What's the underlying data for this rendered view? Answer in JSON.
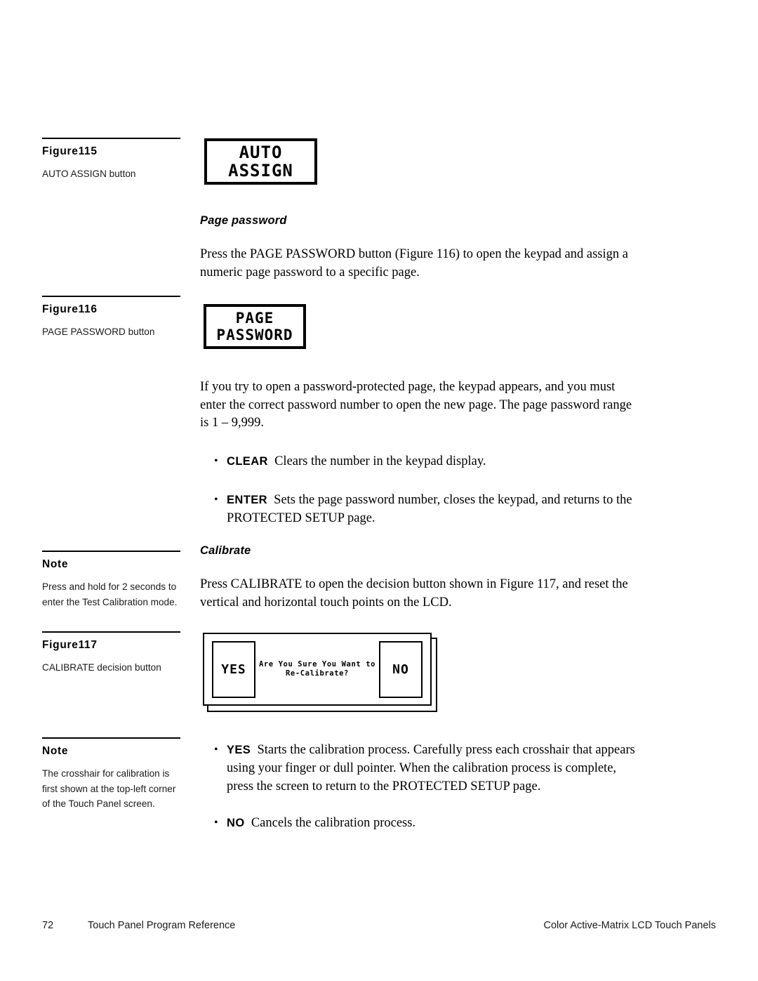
{
  "document": {
    "page_number": "72",
    "footer_left": "Touch Panel Program Reference",
    "footer_right": "Color Active-Matrix LCD Touch Panels"
  },
  "figures": {
    "fig115": {
      "label": "Figure115",
      "caption": "AUTO ASSIGN button",
      "button_line1": "AUTO",
      "button_line2": "ASSIGN"
    },
    "fig116": {
      "label": "Figure116",
      "caption": "PAGE PASSWORD button",
      "button_line1": "PAGE",
      "button_line2": "PASSWORD"
    },
    "fig117": {
      "label": "Figure117",
      "caption": "CALIBRATE decision button",
      "yes_label": "YES",
      "no_label": "NO",
      "prompt_line1": "Are You Sure You Want to",
      "prompt_line2": "Re-Calibrate?"
    }
  },
  "notes": {
    "note1": {
      "label": "Note",
      "body": "Press and hold for 2 seconds to enter the Test Calibration mode."
    },
    "note2": {
      "label": "Note",
      "body": "The crosshair for calibration is first shown at the top-left corner of the Touch Panel screen."
    }
  },
  "sections": {
    "page_password": {
      "heading": "Page password",
      "paragraph1": "Press the PAGE PASSWORD button (Figure 116) to open the keypad and assign a numeric page password to a specific page.",
      "paragraph2": "If you try to open a password-protected page, the keypad appears, and you must enter the correct password number to open the new page. The page password range is 1 – 9,999.",
      "bullets": [
        {
          "marker": "•",
          "term": "CLEAR",
          "text": "Clears the number in the keypad display."
        },
        {
          "marker": "•",
          "term": "ENTER",
          "text": "Sets the page password number, closes the keypad, and returns to the PROTECTED SETUP page."
        }
      ]
    },
    "calibrate": {
      "heading": "Calibrate",
      "paragraph1": "Press CALIBRATE to open the decision button shown in Figure 117, and reset the vertical and horizontal touch points on the LCD.",
      "bullets": [
        {
          "marker": "•",
          "term": "YES",
          "text": "Starts the calibration process. Carefully press each crosshair that appears using your finger or dull pointer. When the calibration process is complete, press the screen to return to the PROTECTED SETUP page."
        },
        {
          "marker": "•",
          "term": "NO",
          "text": "Cancels the calibration process."
        }
      ]
    }
  },
  "colors": {
    "ink": "#000000",
    "paper": "#ffffff",
    "body_text": "#1a1a1a"
  }
}
